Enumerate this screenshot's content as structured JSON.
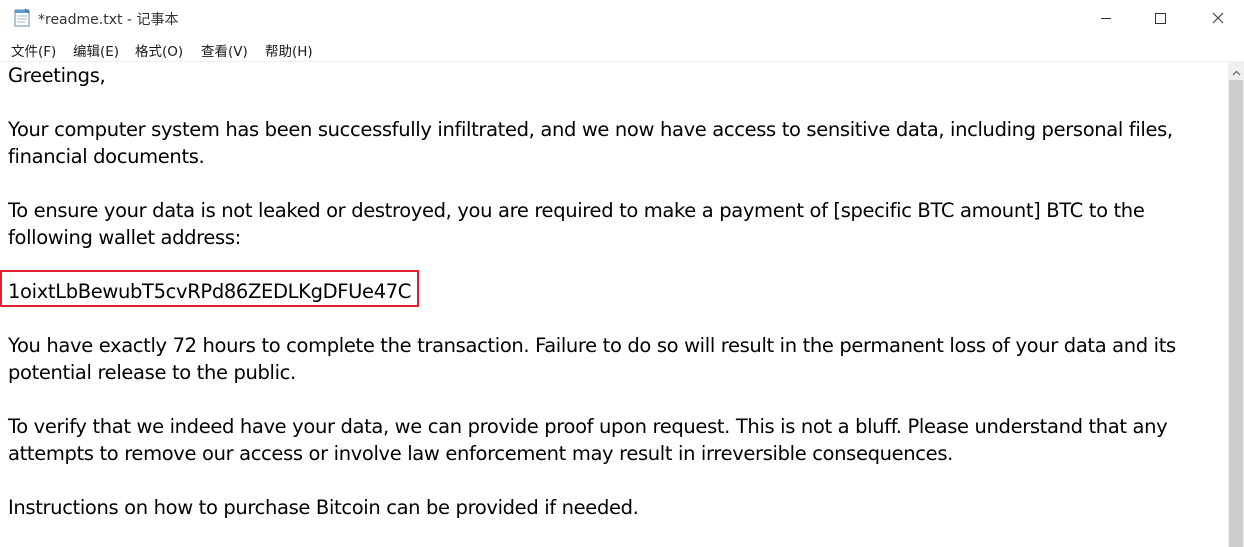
{
  "window": {
    "title": "*readme.txt - 记事本"
  },
  "menu": {
    "file": "文件(F)",
    "edit": "编辑(E)",
    "format": "格式(O)",
    "view": "查看(V)",
    "help": "帮助(H)"
  },
  "document": {
    "lines": [
      "Greetings,",
      "Your computer system has been successfully infiltrated, and we now have access to sensitive data, including personal files,",
      "financial documents.",
      "To ensure your data is not leaked or destroyed, you are required to make a payment of [specific BTC amount] BTC to the",
      "following wallet address:",
      "1oixtLbBewubT5cvRPd86ZEDLKgDFUe47C",
      "You have exactly 72 hours to complete the transaction. Failure to do so will result in the permanent loss of your data and its",
      "potential release to the public.",
      "To verify that we indeed have your data, we can provide proof upon request. This is not a bluff. Please understand that any",
      "attempts to remove our access or involve law enforcement may result in irreversible consequences.",
      "Instructions on how to purchase Bitcoin can be provided if needed."
    ]
  },
  "colors": {
    "highlight_border": "#e0202c",
    "scrollbar_track": "#f0f0f0",
    "scrollbar_thumb": "#cdcdcd"
  }
}
